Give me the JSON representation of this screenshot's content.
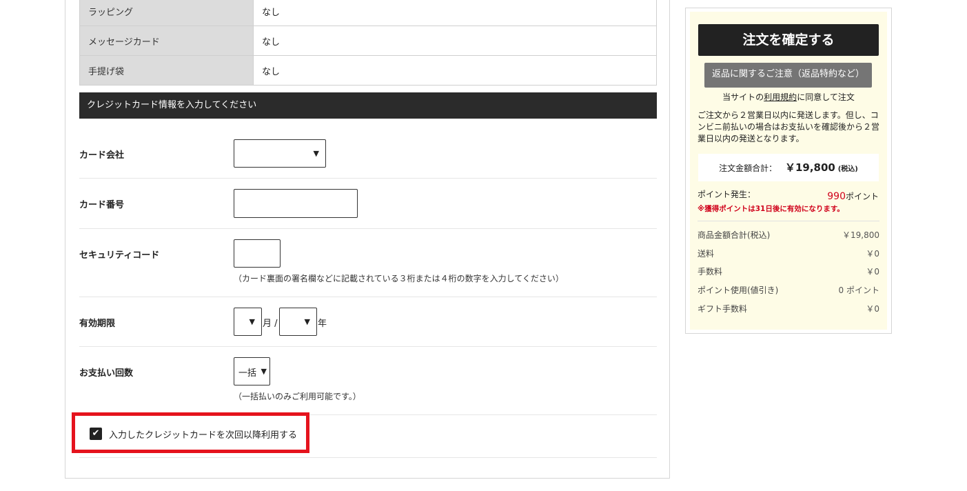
{
  "options": [
    {
      "label": "ラッピング",
      "value": "なし"
    },
    {
      "label": "メッセージカード",
      "value": "なし"
    },
    {
      "label": "手提げ袋",
      "value": "なし"
    }
  ],
  "cc": {
    "header": "クレジットカード情報を入力してください",
    "card_company": "カード会社",
    "card_number": "カード番号",
    "security_code": "セキュリティコード",
    "security_note": "（カード裏面の署名欄などに記載されている３桁または４桁の数字を入力してください）",
    "expiry": "有効期限",
    "month_unit": "月 /",
    "year_unit": "年",
    "installments": "お支払い回数",
    "installment_value": "一括",
    "installment_note": "（一括払いのみご利用可能です。）",
    "save_label": "入力したクレジットカードを次回以降利用する",
    "save_checked": true
  },
  "sidebar": {
    "confirm": "注文を確定する",
    "returns": "返品に関するご注意（返品特約など）",
    "agree_pre": "当サイトの",
    "agree_link": "利用規約",
    "agree_post": "に同意して注文",
    "shipping_note": "ご注文から２営業日以内に発送します。但し、コンビニ前払いの場合はお支払いを確認後から２営業日以内の発送となります。",
    "total_label": "注文金額合計：",
    "total_value": "￥19,800",
    "total_tax": "(税込)",
    "points_label": "ポイント発生：",
    "points_value": "990",
    "points_unit": "ポイント",
    "points_note": "※獲得ポイントは31日後に有効になります。",
    "summary": [
      {
        "label": "商品金額合計(税込)",
        "value": "￥19,800"
      },
      {
        "label": "送料",
        "value": "￥0"
      },
      {
        "label": "手数料",
        "value": "￥0"
      },
      {
        "label": "ポイント使用(値引き)",
        "value": "0 ポイント"
      },
      {
        "label": "ギフト手数料",
        "value": "￥0"
      }
    ]
  },
  "icons": {
    "caret": "▼",
    "check": "✔"
  },
  "colors": {
    "accent_red": "#e5131d",
    "dark": "#222222",
    "sidebar_bg": "#fefce6"
  }
}
